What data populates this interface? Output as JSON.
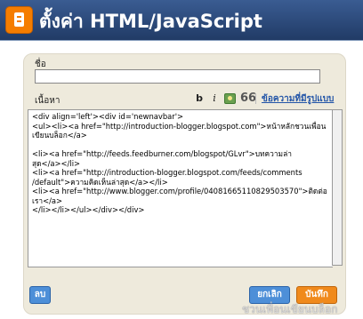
{
  "window": {
    "title": "ตั้งค่า HTML/JavaScript"
  },
  "form": {
    "name_label": "ชื่อ",
    "name_value": "",
    "content_label": "เนื้อหา",
    "toolbar": {
      "bold": "b",
      "italic": "i",
      "quote": "66",
      "rich_text_link": "ข้อความที่มีรูปแบบ"
    },
    "content_lines": [
      "<div align='left'><div id='newnavbar'>",
      "<ul><li><a href=\"http://introduction-blogger.blogspot.com\">หน้าหลักชวนเพื่อน",
      "เขียนบล็อก</a>",
      "",
      "<li><a href=\"http://feeds.feedburner.com/blogspot/GLvr\">บทความล่า",
      "สุด</a></li>",
      "<li><a href=\"http://introduction-blogger.blogspot.com/feeds/comments",
      "/default\">ความคิดเห็นล่าสุด</a></li>",
      "<li><a href=\"http://www.blogger.com/profile/04081665110829503570\">ติดต่อ",
      "เรา</a>",
      "</li></li></ul></div></div>"
    ]
  },
  "buttons": {
    "delete": "ลบ",
    "cancel": "ยกเลิก",
    "save": "บันทึก"
  },
  "watermark": "ชวนเพื่อนเขียนบล็อก",
  "colors": {
    "titlebar": "#2b4a7a",
    "panel": "#eeeadc",
    "blue_button": "#4d8fd8",
    "save_button": "#f08a1c",
    "link": "#2456a8"
  }
}
